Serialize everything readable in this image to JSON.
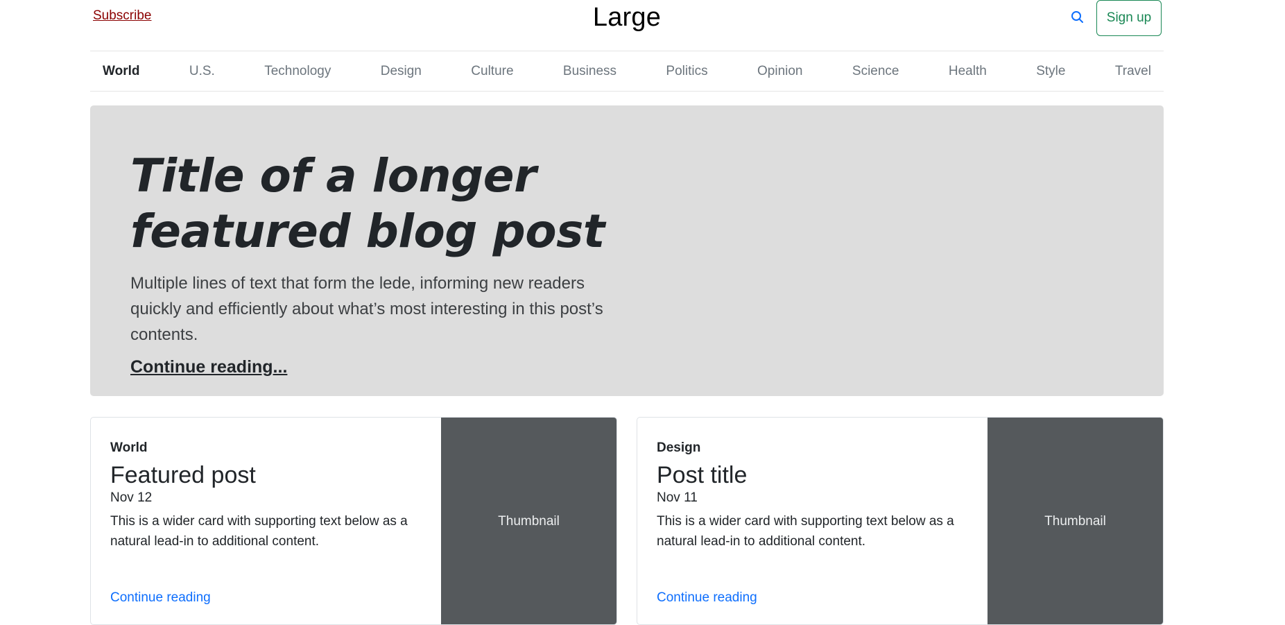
{
  "header": {
    "subscribe_label": "Subscribe",
    "logo_text": "Large",
    "search_icon": "search-icon",
    "signup_label": "Sign up"
  },
  "nav": {
    "items": [
      {
        "label": "World",
        "active": true
      },
      {
        "label": "U.S."
      },
      {
        "label": "Technology"
      },
      {
        "label": "Design"
      },
      {
        "label": "Culture"
      },
      {
        "label": "Business"
      },
      {
        "label": "Politics"
      },
      {
        "label": "Opinion"
      },
      {
        "label": "Science"
      },
      {
        "label": "Health"
      },
      {
        "label": "Style"
      },
      {
        "label": "Travel"
      }
    ]
  },
  "hero": {
    "title": "Title of a longer featured blog post",
    "lede": "Multiple lines of text that form the lede, informing new readers quickly and efficiently about what’s most interesting in this post’s contents.",
    "link_label": "Continue reading..."
  },
  "cards": [
    {
      "category": "World",
      "title": "Featured post",
      "date": "Nov 12",
      "text": "This is a wider card with supporting text below as a natural lead-in to additional content.",
      "link_label": "Continue reading",
      "thumbnail_label": "Thumbnail"
    },
    {
      "category": "Design",
      "title": "Post title",
      "date": "Nov 11",
      "text": "This is a wider card with supporting text below as a natural lead-in to additional content.",
      "link_label": "Continue reading",
      "thumbnail_label": "Thumbnail"
    }
  ],
  "colors": {
    "subscribe": "#8b0000",
    "signup_accent": "#198754",
    "link_blue": "#0d6efd",
    "hero_bg": "#dddddd",
    "thumbnail_bg": "#55595c"
  }
}
